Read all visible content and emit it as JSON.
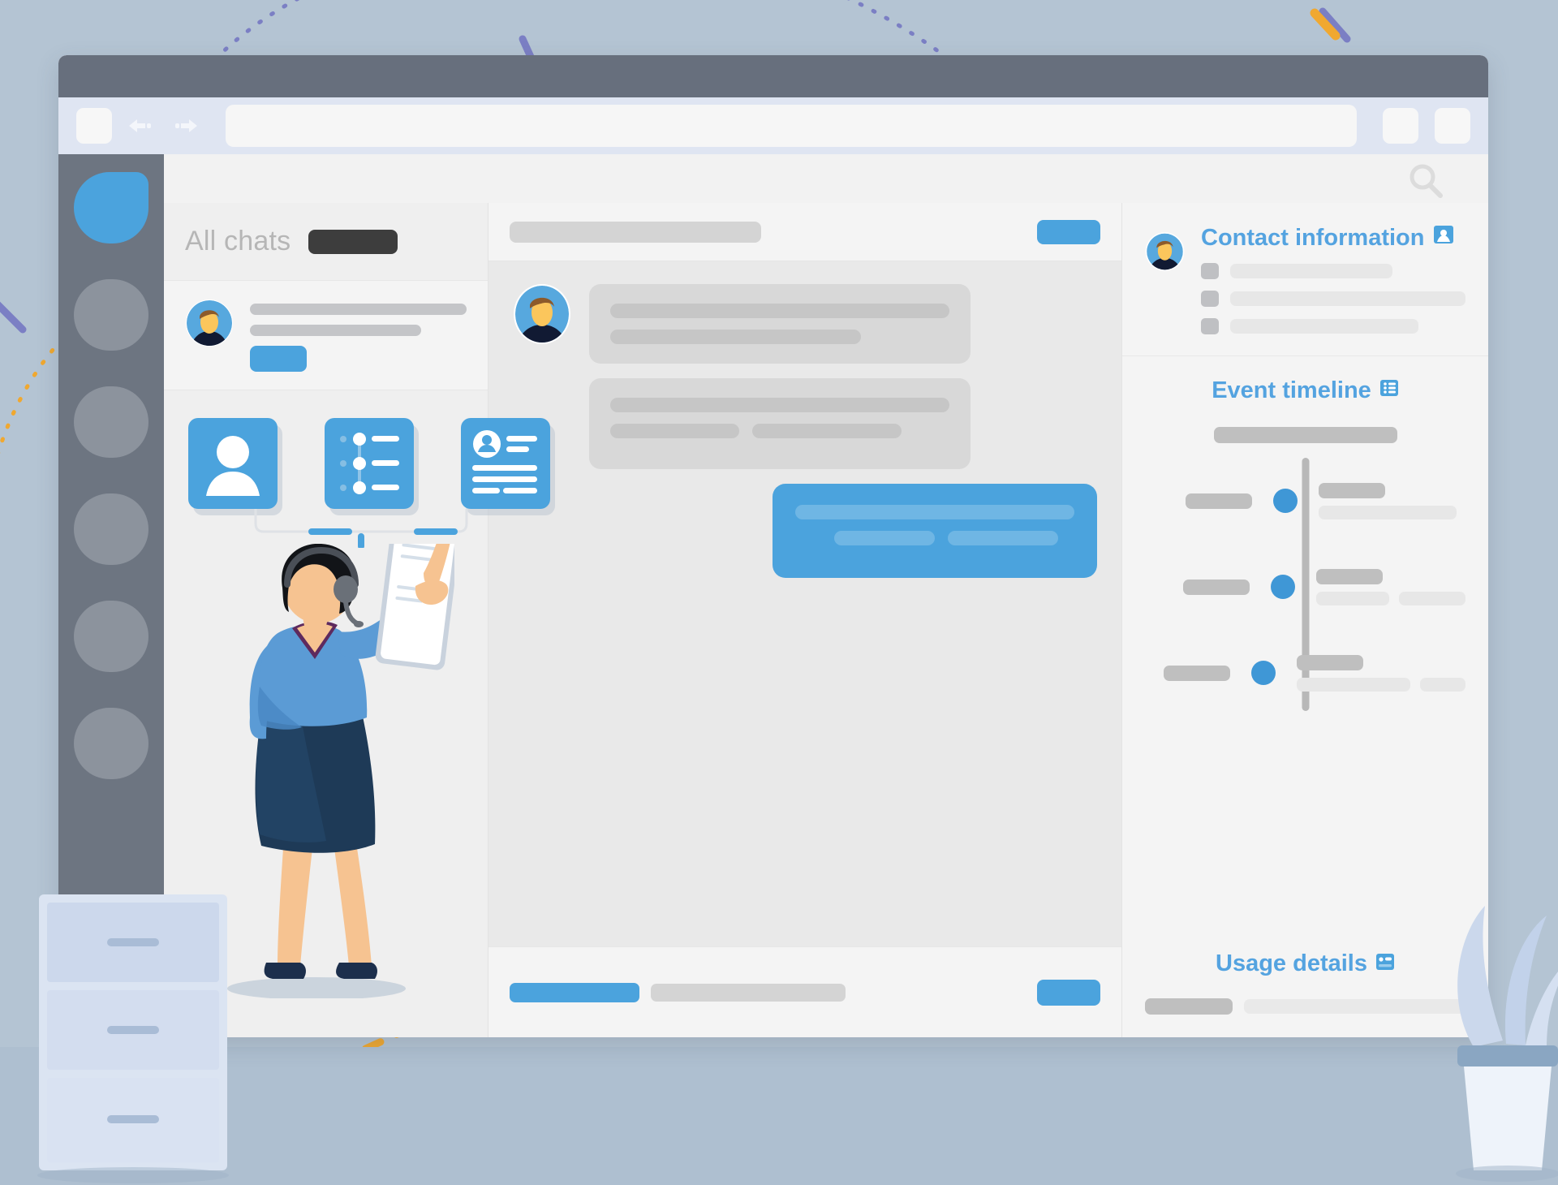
{
  "scene": {
    "background_color": "#b4c4d3",
    "accent_color": "#4ba3dd",
    "title": "Customer support helpdesk illustration"
  },
  "browser": {
    "titlebar_color": "#676f7d",
    "toolbar_color": "#dfe5f2",
    "back_icon": "arrow-left-icon",
    "forward_icon": "arrow-right-icon",
    "url_value": "",
    "url_placeholder": "",
    "tab_button": "",
    "right_buttons": [
      "",
      ""
    ]
  },
  "rail": {
    "items": [
      {
        "name": "rail-avatar-active",
        "active": true
      },
      {
        "name": "rail-avatar-2",
        "active": false
      },
      {
        "name": "rail-avatar-3",
        "active": false
      },
      {
        "name": "rail-avatar-4",
        "active": false
      },
      {
        "name": "rail-avatar-5",
        "active": false
      },
      {
        "name": "rail-avatar-6",
        "active": false
      }
    ]
  },
  "search": {
    "icon": "search-icon"
  },
  "chats": {
    "title": "All chats",
    "filter_pill": "",
    "items": [
      {
        "name": "chat-list-item-1",
        "line1": "",
        "line2": "",
        "badge": ""
      }
    ],
    "cards": [
      {
        "name": "card-profile",
        "icon": "user-avatar-icon"
      },
      {
        "name": "card-timeline",
        "icon": "timeline-list-icon"
      },
      {
        "name": "card-contact",
        "icon": "contact-card-icon"
      }
    ]
  },
  "conversation": {
    "header_bar": "",
    "header_button": "",
    "messages": [
      {
        "name": "message-incoming-1",
        "side": "in",
        "lines": 2,
        "avatar": true
      },
      {
        "name": "message-incoming-2",
        "side": "in",
        "lines": 2,
        "avatar": false
      },
      {
        "name": "message-outgoing-1",
        "side": "out",
        "lines": 2,
        "avatar": false
      }
    ],
    "composer": {
      "active_tab": "",
      "secondary_bar": "",
      "send_button": ""
    }
  },
  "info": {
    "contact": {
      "title": "Contact information",
      "icon": "contact-photo-icon",
      "rows": [
        {
          "key": "",
          "value": ""
        },
        {
          "key": "",
          "value": ""
        },
        {
          "key": "",
          "value": ""
        }
      ]
    },
    "timeline": {
      "title": "Event timeline",
      "icon": "timeline-grid-icon",
      "header_bar": "",
      "events": [
        {
          "name": "timeline-event-1",
          "left": "",
          "title": "",
          "chips": 1
        },
        {
          "name": "timeline-event-2",
          "left": "",
          "title": "",
          "chips": 2
        },
        {
          "name": "timeline-event-3",
          "left": "",
          "title": "",
          "chips": 2
        }
      ]
    },
    "usage": {
      "title": "Usage details",
      "icon": "usage-badge-icon",
      "rows": [
        {
          "key": "",
          "value": ""
        }
      ]
    }
  },
  "illustration": {
    "agent": {
      "name": "support-agent-figure",
      "headset": "headset-icon",
      "device": "tablet-device",
      "sweater_color": "#5b9bd5",
      "skirt_color": "#1e3a57",
      "hair_color": "#111318"
    },
    "cabinet": {
      "name": "filing-cabinet",
      "drawers": 3,
      "color": "#cdd9ea"
    },
    "plant": {
      "name": "potted-plant",
      "pot_color": "#e8eef7",
      "leaf_color": "#cbd8ec"
    },
    "decor": {
      "dashed_curve_color": "#f0a830",
      "dotted_arc_color": "#7b7fc4",
      "tick_color": "#f0a830",
      "ring": "floor-ring-decor"
    }
  }
}
